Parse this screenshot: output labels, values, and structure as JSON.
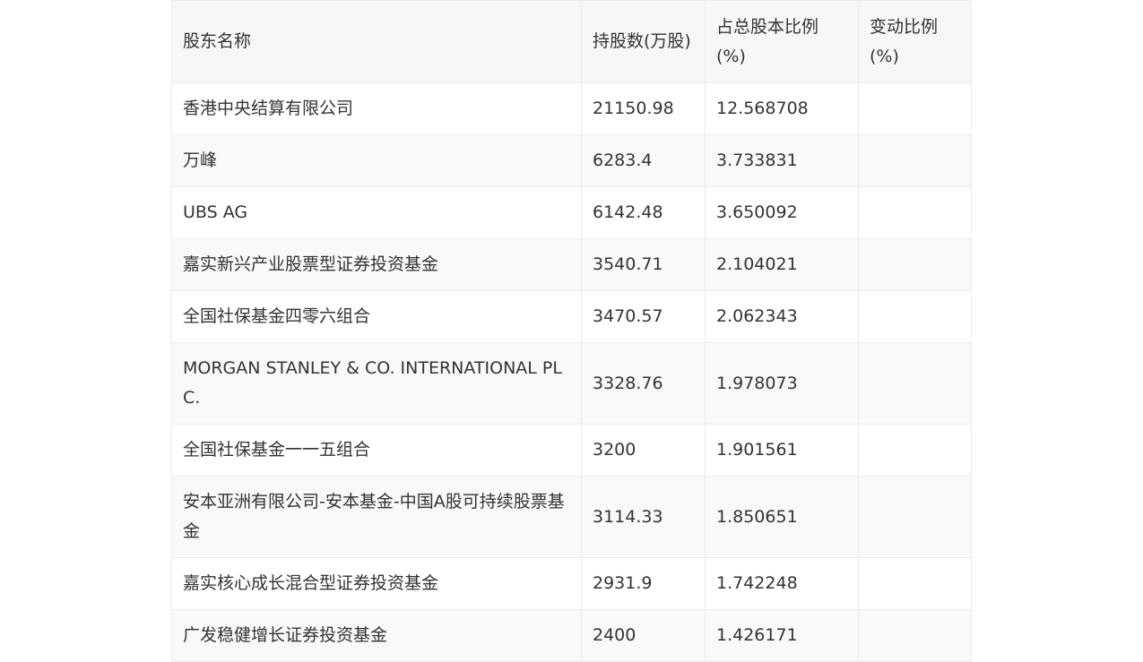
{
  "table": {
    "headers": [
      "股东名称",
      "持股数(万股)",
      "占总股本比例(%)",
      "变动比例(%)"
    ],
    "rows": [
      {
        "name": "香港中央结算有限公司",
        "shares": "21150.98",
        "ratio": "12.568708",
        "change": ""
      },
      {
        "name": "万峰",
        "shares": "6283.4",
        "ratio": "3.733831",
        "change": ""
      },
      {
        "name": "UBS AG",
        "shares": "6142.48",
        "ratio": "3.650092",
        "change": ""
      },
      {
        "name": "嘉实新兴产业股票型证券投资基金",
        "shares": "3540.71",
        "ratio": "2.104021",
        "change": ""
      },
      {
        "name": "全国社保基金四零六组合",
        "shares": "3470.57",
        "ratio": "2.062343",
        "change": ""
      },
      {
        "name": "MORGAN STANLEY & CO. INTERNATIONAL PLC.",
        "shares": "3328.76",
        "ratio": "1.978073",
        "change": ""
      },
      {
        "name": "全国社保基金一一五组合",
        "shares": "3200",
        "ratio": "1.901561",
        "change": ""
      },
      {
        "name": "安本亚洲有限公司-安本基金-中国A股可持续股票基金",
        "shares": "3114.33",
        "ratio": "1.850651",
        "change": ""
      },
      {
        "name": "嘉实核心成长混合型证券投资基金",
        "shares": "2931.9",
        "ratio": "1.742248",
        "change": ""
      },
      {
        "name": "广发稳健增长证券投资基金",
        "shares": "2400",
        "ratio": "1.426171",
        "change": ""
      }
    ]
  }
}
